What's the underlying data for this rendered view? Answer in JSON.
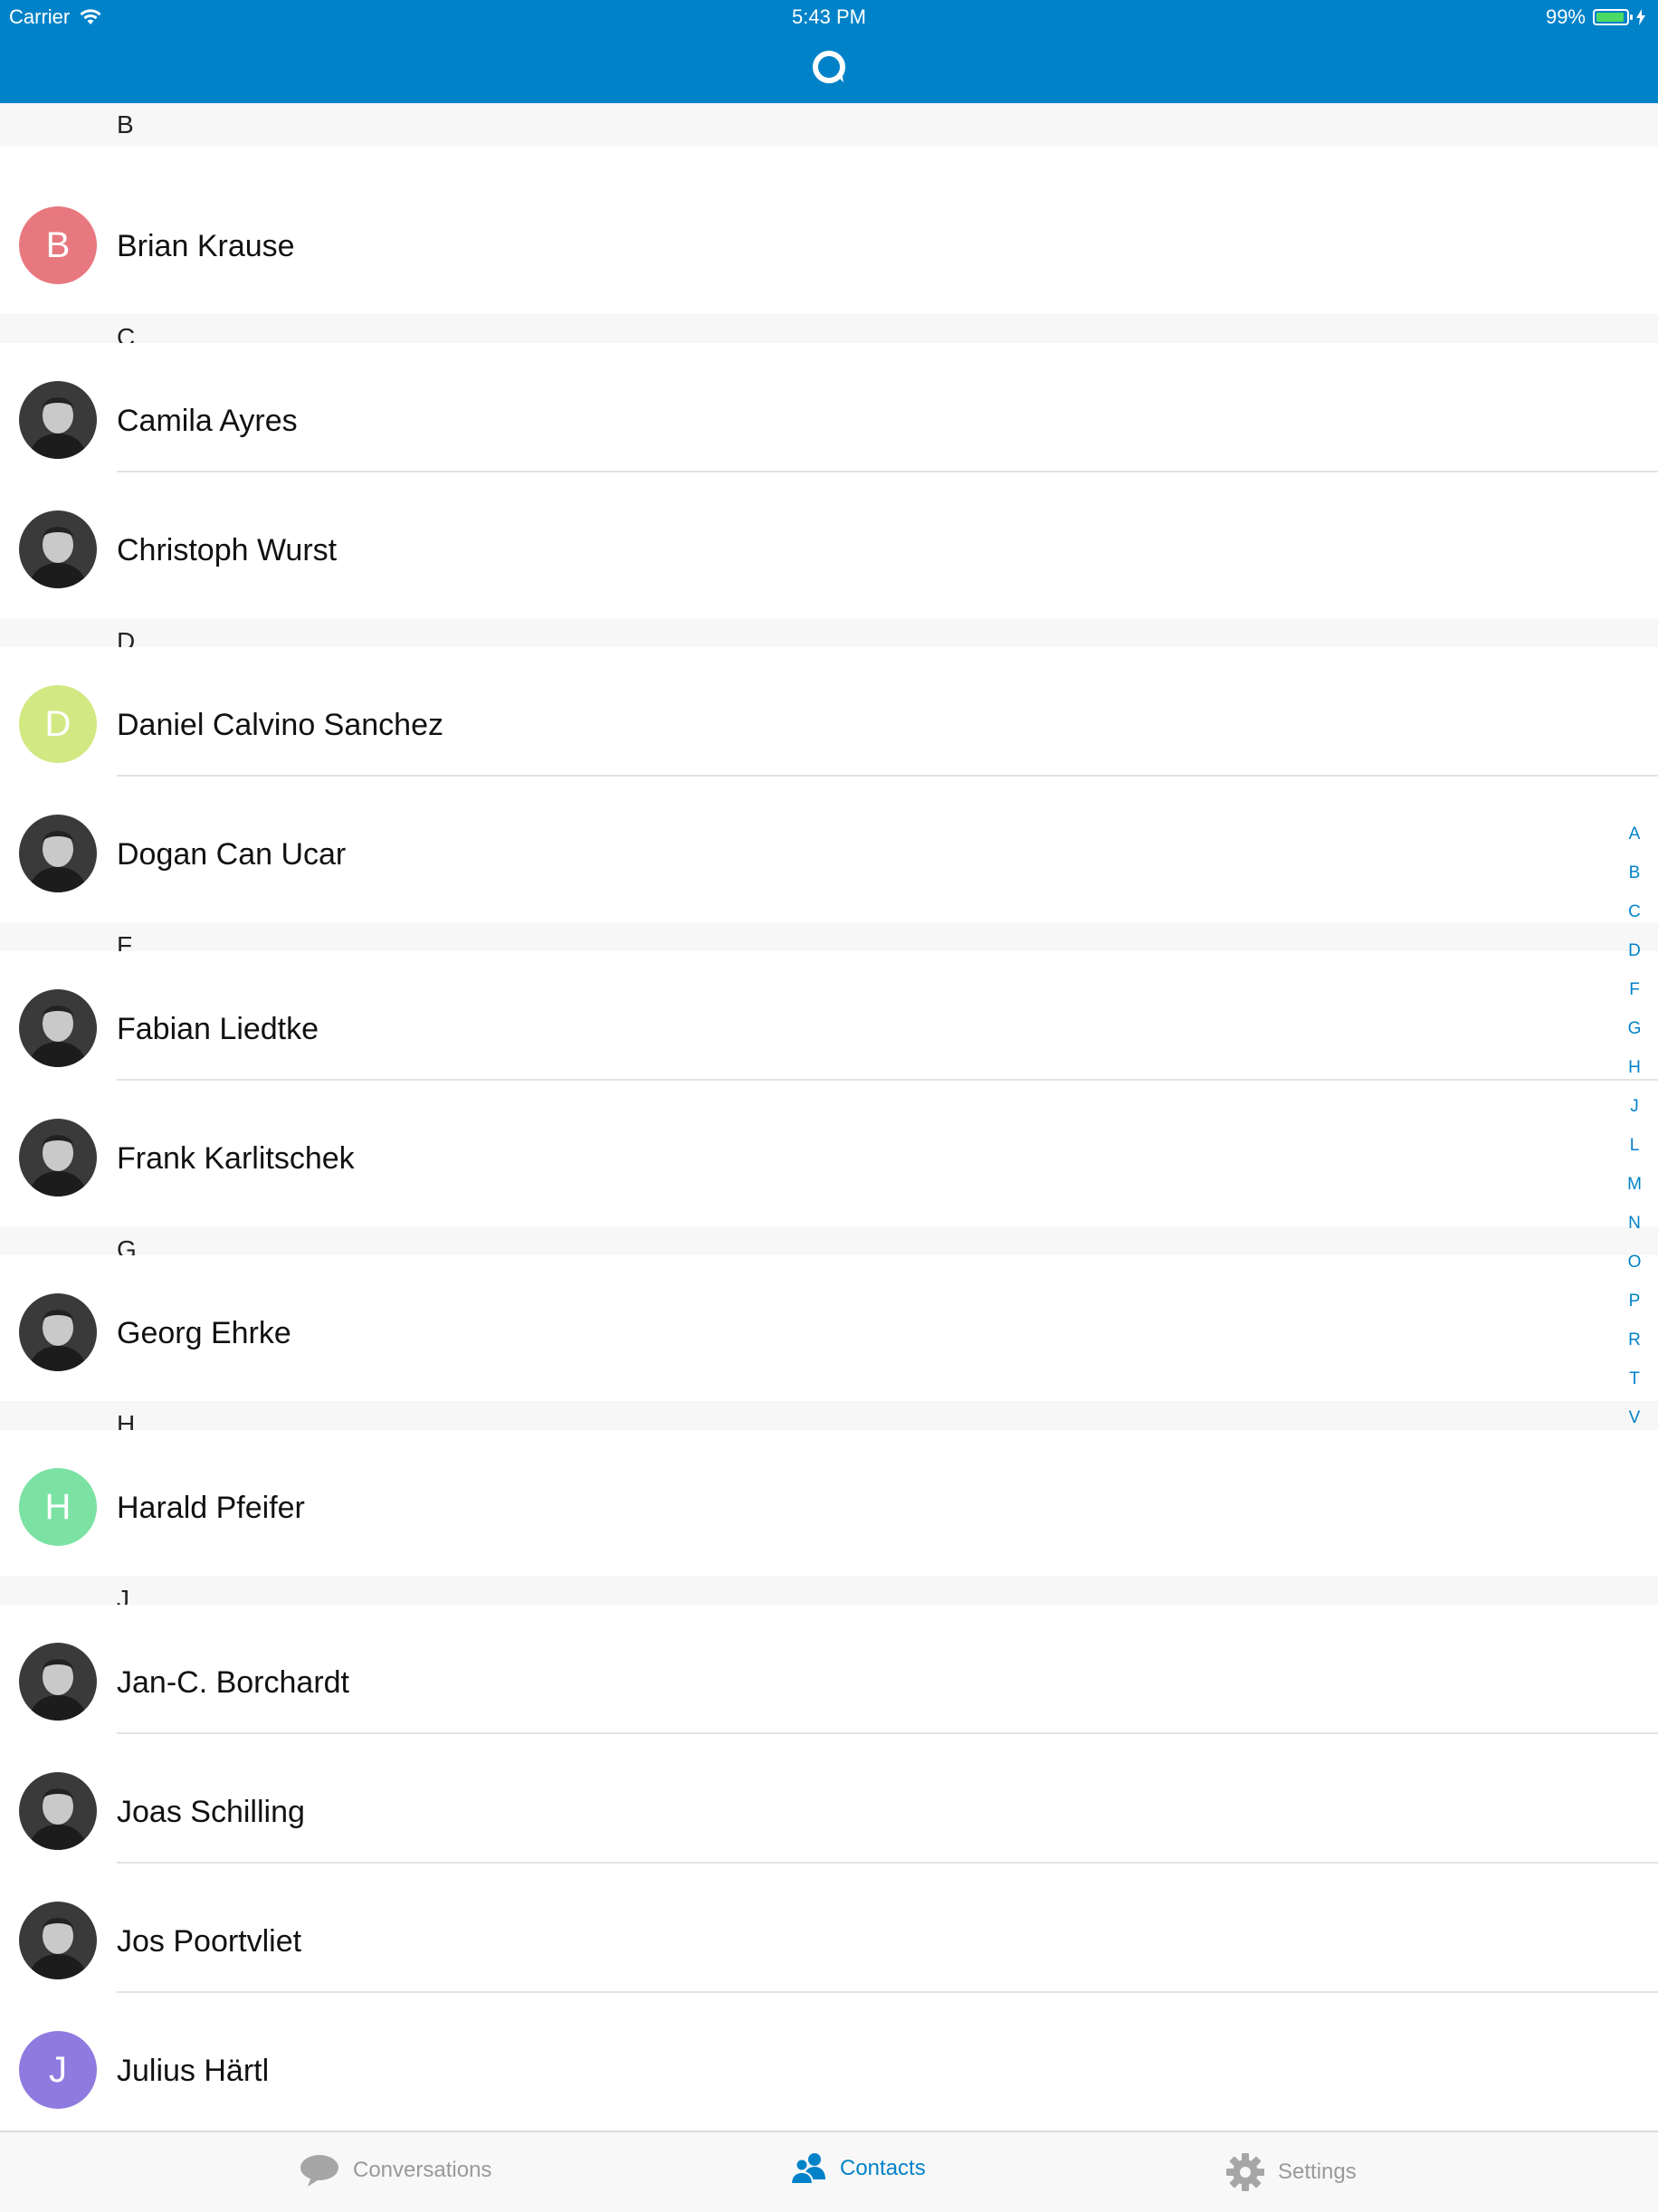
{
  "status_bar": {
    "carrier": "Carrier",
    "time": "5:43 PM",
    "battery_percent": "99%",
    "battery_level": 0.99
  },
  "colors": {
    "brand": "#0082c9",
    "section_bg": "#f7f7f7",
    "separator": "#e3e3e3"
  },
  "nav": {
    "logo_icon": "talk-logo-icon"
  },
  "partial_section": "B",
  "contacts": [
    {
      "name": "Brian Krause",
      "initial": "B",
      "avatar_color": "#e8787f",
      "avatar_type": "initial",
      "section": "B"
    },
    {
      "name": "Camila Ayres",
      "avatar_type": "photo",
      "section": "C",
      "section_start": true
    },
    {
      "name": "Christoph Wurst",
      "avatar_type": "photo",
      "section": "C"
    },
    {
      "name": "Daniel Calvino Sanchez",
      "initial": "D",
      "avatar_color": "#d2e882",
      "avatar_type": "initial",
      "section": "D",
      "section_start": true
    },
    {
      "name": "Dogan Can Ucar",
      "avatar_type": "photo",
      "section": "D"
    },
    {
      "name": "Fabian Liedtke",
      "avatar_type": "photo",
      "section": "F",
      "section_start": true
    },
    {
      "name": "Frank Karlitschek",
      "avatar_type": "photo",
      "section": "F"
    },
    {
      "name": "Georg Ehrke",
      "avatar_type": "photo",
      "section": "G",
      "section_start": true
    },
    {
      "name": "Harald Pfeifer",
      "initial": "H",
      "avatar_color": "#7be2a4",
      "avatar_type": "initial",
      "section": "H",
      "section_start": true
    },
    {
      "name": "Jan-C. Borchardt",
      "avatar_type": "photo",
      "section": "J",
      "section_start": true
    },
    {
      "name": "Joas Schilling",
      "avatar_type": "photo",
      "section": "J"
    },
    {
      "name": "Jos Poortvliet",
      "avatar_type": "photo",
      "section": "J"
    },
    {
      "name": "Julius Härtl",
      "initial": "J",
      "avatar_color": "#8f7bdf",
      "avatar_type": "initial",
      "section": "J"
    }
  ],
  "index_letters": [
    "A",
    "B",
    "C",
    "D",
    "F",
    "G",
    "H",
    "J",
    "L",
    "M",
    "N",
    "O",
    "P",
    "R",
    "T",
    "V"
  ],
  "tabs": [
    {
      "label": "Conversations",
      "icon": "speech-bubble-icon",
      "active": false
    },
    {
      "label": "Contacts",
      "icon": "contacts-icon",
      "active": true
    },
    {
      "label": "Settings",
      "icon": "gear-icon",
      "active": false
    }
  ]
}
